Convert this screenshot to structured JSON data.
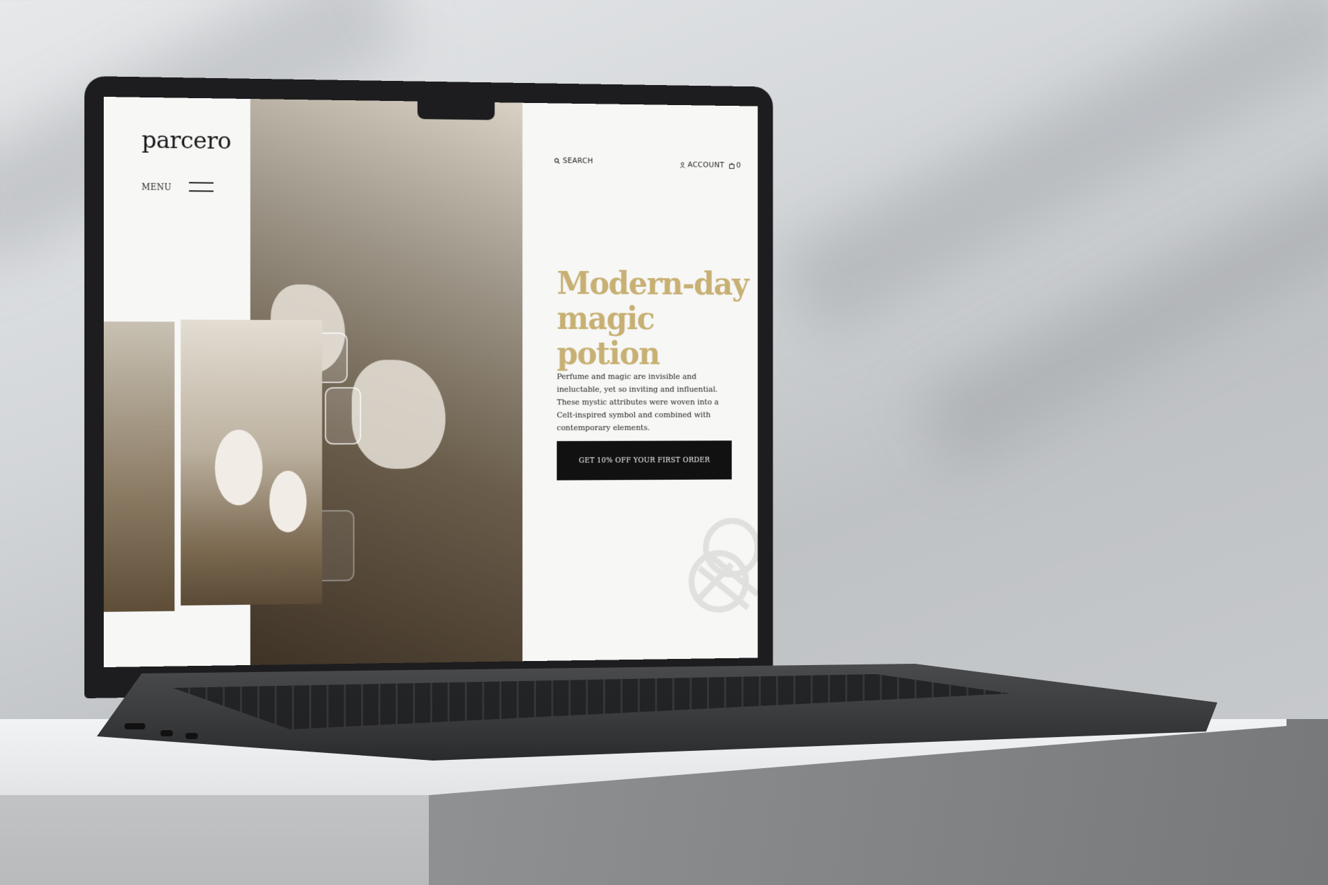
{
  "site": {
    "logo": "parcero",
    "menu_label": "MENU",
    "header": {
      "search_label": "SEARCH",
      "account_label": "ACCOUNT",
      "cart_count": "0"
    },
    "hero": {
      "headline_line1": "Modern-day",
      "headline_line2": "magic potion",
      "body": "Perfume and magic are invisible and ineluctable, yet so inviting and influential. These mystic attributes were woven into a Celt-inspired symbol and combined with contemporary elements.",
      "cta_label": "GET 10% OFF YOUR FIRST ORDER"
    },
    "colors": {
      "accent_gold": "#c7b073",
      "text_dark": "#1a1a1a",
      "cta_background": "#111111",
      "panel_background": "#f7f7f6"
    },
    "icons": [
      "search-icon",
      "account-icon",
      "cart-icon",
      "hamburger-icon",
      "celtic-knot-icon"
    ]
  }
}
